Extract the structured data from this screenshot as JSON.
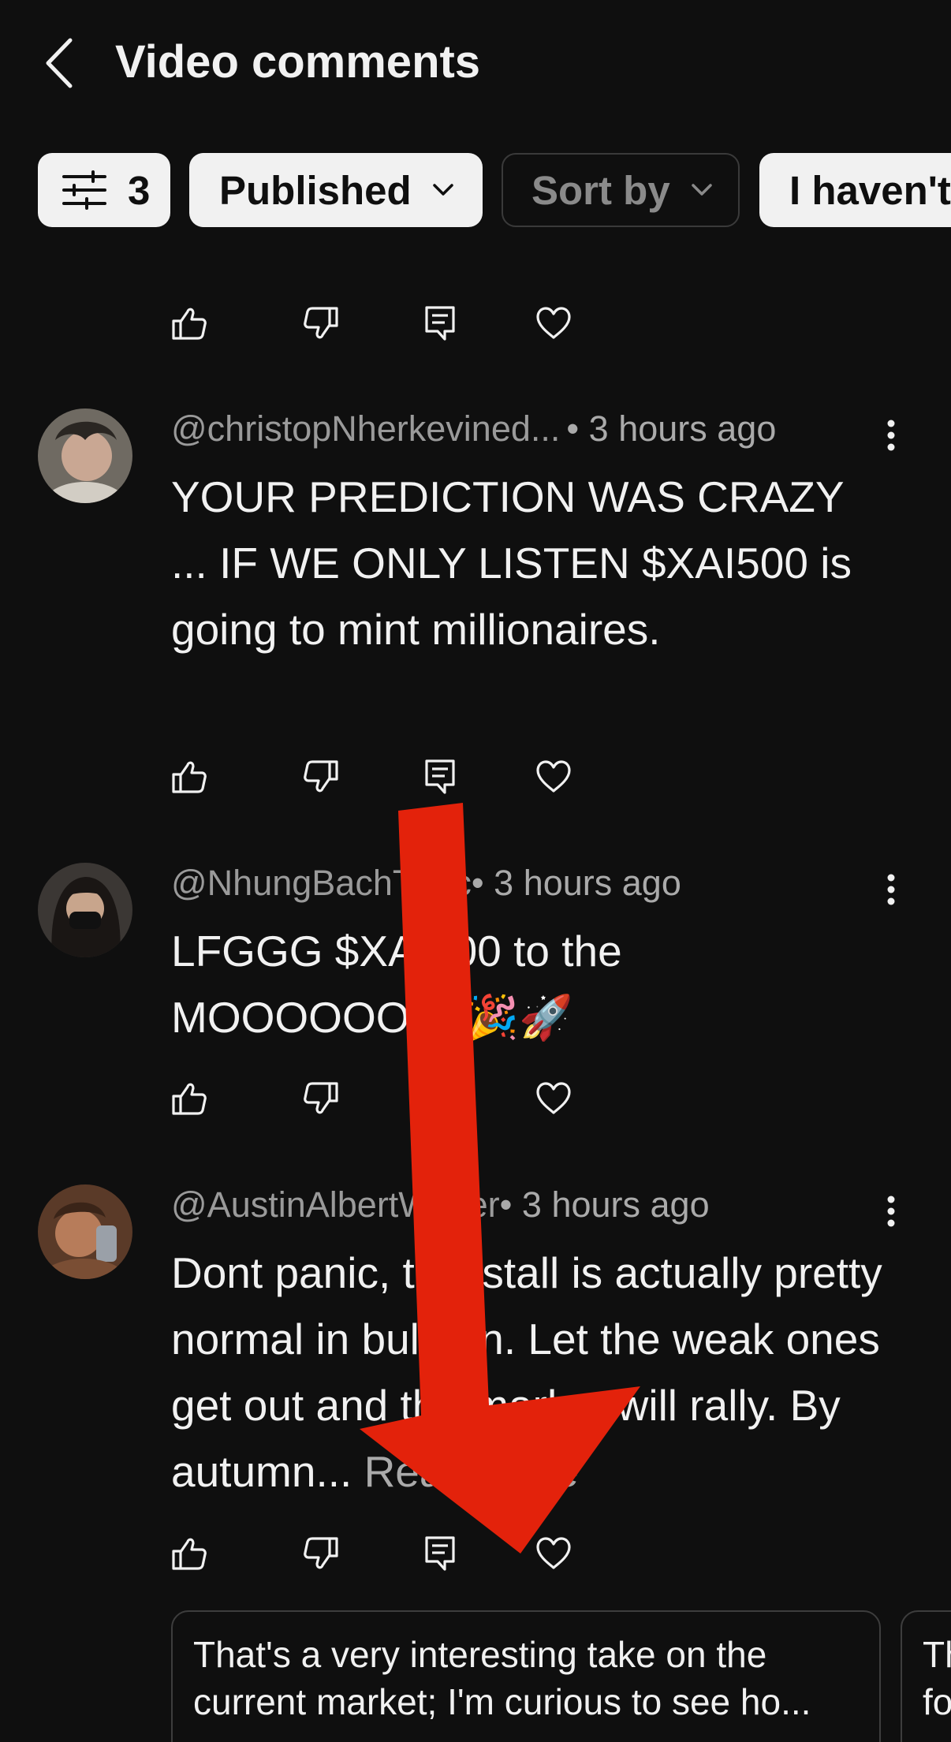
{
  "header": {
    "title": "Video comments",
    "back_icon": "chevron-left-icon"
  },
  "filters": {
    "filter_count": "3",
    "published_label": "Published",
    "sort_label": "Sort by",
    "haven_label": "I haven't"
  },
  "comments": [
    {
      "author": "@christopNherkevined...",
      "time": " • 3 hours ago",
      "text": "YOUR PREDICTION WAS CRAZY ... IF WE ONLY LISTEN $XAI500 is going to mint millionaires."
    },
    {
      "author": "@NhungBachThuc",
      "time": " • 3 hours ago",
      "text": "LFGGG $XAI500 to the MOOOOOON!!🎉🚀"
    },
    {
      "author": "@AustinAlbertWalter",
      "time": " • 3 hours ago",
      "text": "Dont panic, this stall is actually pretty normal in bull run. Let the weak ones get out and the market will rally. By autumn... ",
      "read_more": "Read more"
    }
  ],
  "suggestions": [
    {
      "line1": "That's a very interesting take on the",
      "line2": "current market; I'm curious to see ho..."
    },
    {
      "line1": "Th",
      "line2": "fo"
    }
  ],
  "colors": {
    "background": "#0f0f0f",
    "chip_light": "#f1f1f1",
    "annotation_arrow": "#e3220b"
  }
}
